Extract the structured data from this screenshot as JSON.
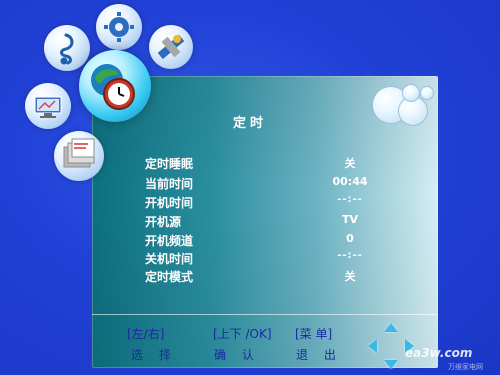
{
  "menu": {
    "title": "定时",
    "rows": [
      {
        "label": "定时睡眠",
        "value": "关"
      },
      {
        "label": "当前时间",
        "value": "00:44"
      },
      {
        "label": "开机时间",
        "value": "--:--"
      },
      {
        "label": "开机源",
        "value": "TV"
      },
      {
        "label": "开机频道",
        "value": "0"
      },
      {
        "label": "关机时间",
        "value": "--:--"
      },
      {
        "label": "定时模式",
        "value": "关"
      }
    ]
  },
  "help": {
    "keys": [
      "[左/右]",
      "[上下 /OK]",
      "[菜 单]"
    ],
    "actions": [
      "选 择",
      "确 认",
      "退 出"
    ]
  },
  "watermark": {
    "main": "ea3w.com",
    "sub": "万维家电网"
  },
  "icons": {
    "music": "music-note-icon",
    "settings": "gear-icon",
    "satellite": "satellite-icon",
    "display": "monitor-icon",
    "timer": "clock-globe-icon",
    "files": "folders-icon"
  },
  "colors": {
    "background": "#1f3fd0",
    "panel_start": "#0d6f7f",
    "panel_end": "#d6eef4",
    "help_text": "#1a2aa0",
    "arrow": "#3ab8e8"
  }
}
